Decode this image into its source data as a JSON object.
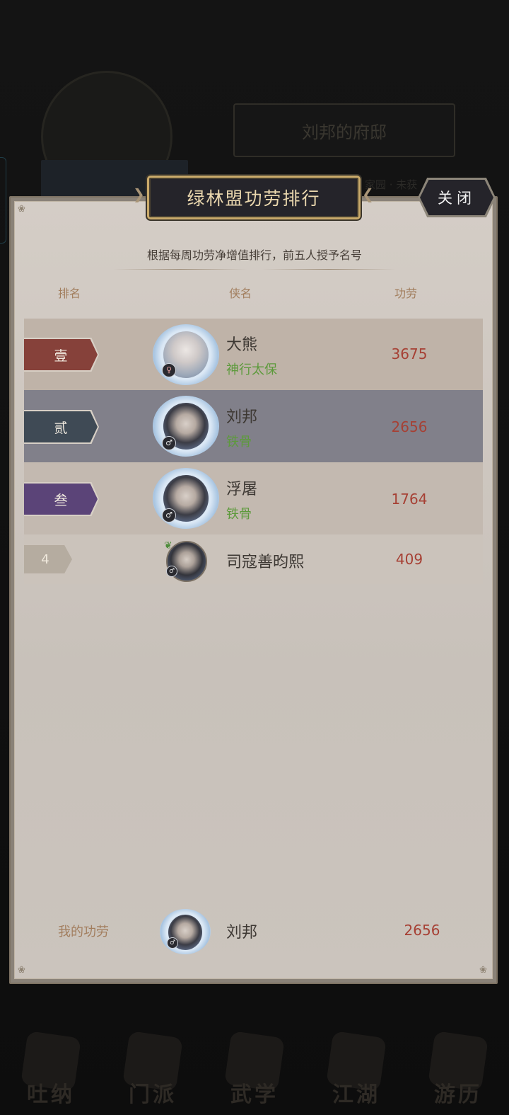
{
  "background": {
    "residence_title": "刘邦的府邸",
    "sub_text": "家园 · 未获"
  },
  "dialog": {
    "title": "绿林盟功劳排行",
    "close_label": "关闭",
    "description": "根据每周功劳净增值排行，前五人授予名号",
    "columns": {
      "rank": "排名",
      "name": "侠名",
      "merit": "功劳"
    }
  },
  "rankings": [
    {
      "rank": "壹",
      "name": "大熊",
      "title": "神行太保",
      "merit": "3675",
      "gender": "female",
      "avatar": "avatar-female-icon",
      "rank_color": "#86413a"
    },
    {
      "rank": "贰",
      "name": "刘邦",
      "title": "铁骨",
      "merit": "2656",
      "gender": "male",
      "avatar": "avatar-male-icon",
      "rank_color": "#3f4a55"
    },
    {
      "rank": "叁",
      "name": "浮屠",
      "title": "铁骨",
      "merit": "1764",
      "gender": "male",
      "avatar": "avatar-male-icon",
      "rank_color": "#5b4478"
    },
    {
      "rank": "4",
      "name": "司寇善昀熙",
      "title": "",
      "merit": "409",
      "gender": "male",
      "avatar": "avatar-male-icon",
      "rank_color": "#b5aca0"
    }
  ],
  "my_merit": {
    "label": "我的功劳",
    "name": "刘邦",
    "merit": "2656",
    "gender": "male"
  },
  "bottom_nav": [
    {
      "label": "吐纳",
      "icon": "meditation-icon"
    },
    {
      "label": "门派",
      "icon": "sect-icon"
    },
    {
      "label": "武学",
      "icon": "martial-arts-icon"
    },
    {
      "label": "江湖",
      "icon": "jianghu-icon"
    },
    {
      "label": "游历",
      "icon": "travel-icon"
    }
  ],
  "colors": {
    "panel_bg": "#d0c9c2",
    "row_rank1": "#bfb3a8",
    "row_rank2": "#81808a",
    "row_rank3": "#c3b9b0",
    "row_rank4": "#cbc3bb",
    "merit_text": "#a64034",
    "title_green": "#5d9a3c",
    "header_gold": "#c9aa6a"
  }
}
